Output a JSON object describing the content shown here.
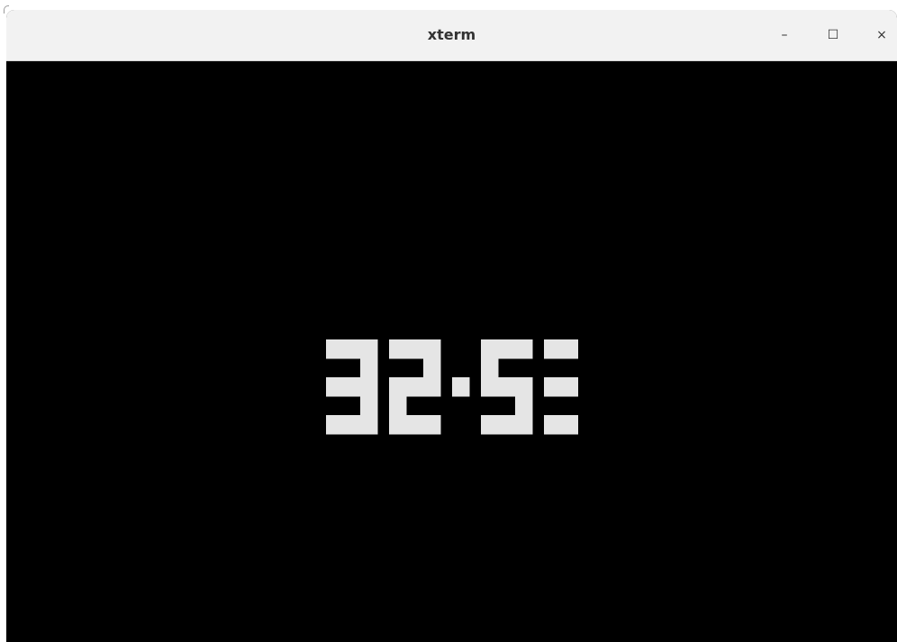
{
  "window": {
    "title": "xterm",
    "controls": {
      "minimize": "–",
      "maximize": "☐",
      "close": "×"
    }
  },
  "terminal": {
    "clock_text": "32:53",
    "foreground": "#e5e5e5",
    "background": "#000000"
  }
}
